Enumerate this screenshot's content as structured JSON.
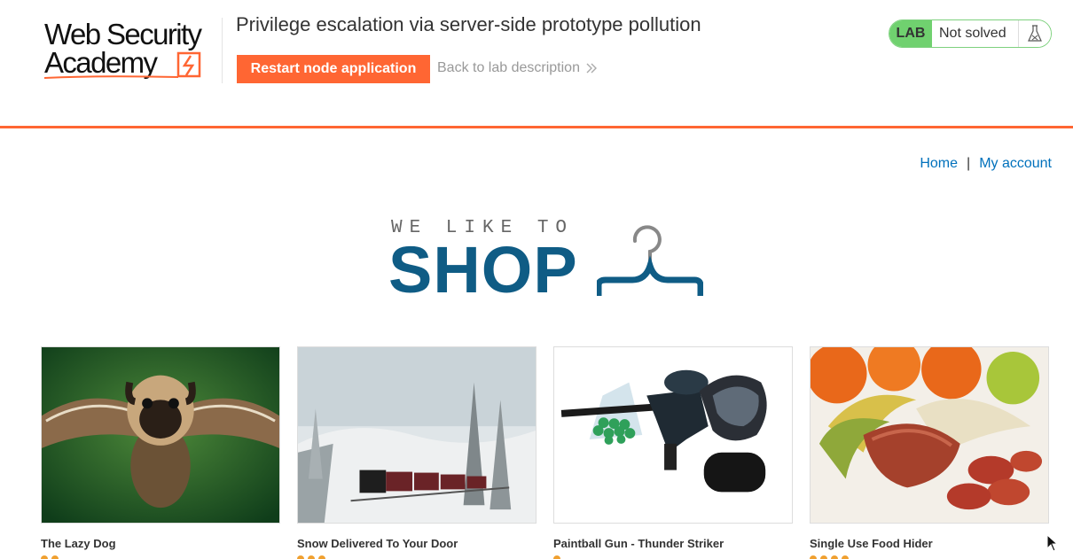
{
  "header": {
    "logo_line1": "Web Security",
    "logo_line2": "Academy",
    "lab_title": "Privilege escalation via server-side prototype pollution",
    "restart_label": "Restart node application",
    "back_label": "Back to lab description",
    "lab_badge": "LAB",
    "lab_status": "Not solved",
    "accent_color": "#ff6633",
    "status_color": "#70d16f"
  },
  "nav": {
    "home": "Home",
    "separator": "|",
    "account": "My account",
    "link_color": "#0071bc"
  },
  "banner": {
    "small": "WE LIKE TO",
    "big": "SHOP",
    "icon": "hanger-icon",
    "color": "#0f5c85"
  },
  "products": [
    {
      "name": "The Lazy Dog",
      "image": "flying-pug-image",
      "rating": 2
    },
    {
      "name": "Snow Delivered To Your Door",
      "image": "snow-train-image",
      "rating": 3
    },
    {
      "name": "Paintball Gun - Thunder Striker",
      "image": "paintball-gun-image",
      "rating": 1
    },
    {
      "name": "Single Use Food Hider",
      "image": "food-hider-image",
      "rating": 4
    }
  ]
}
